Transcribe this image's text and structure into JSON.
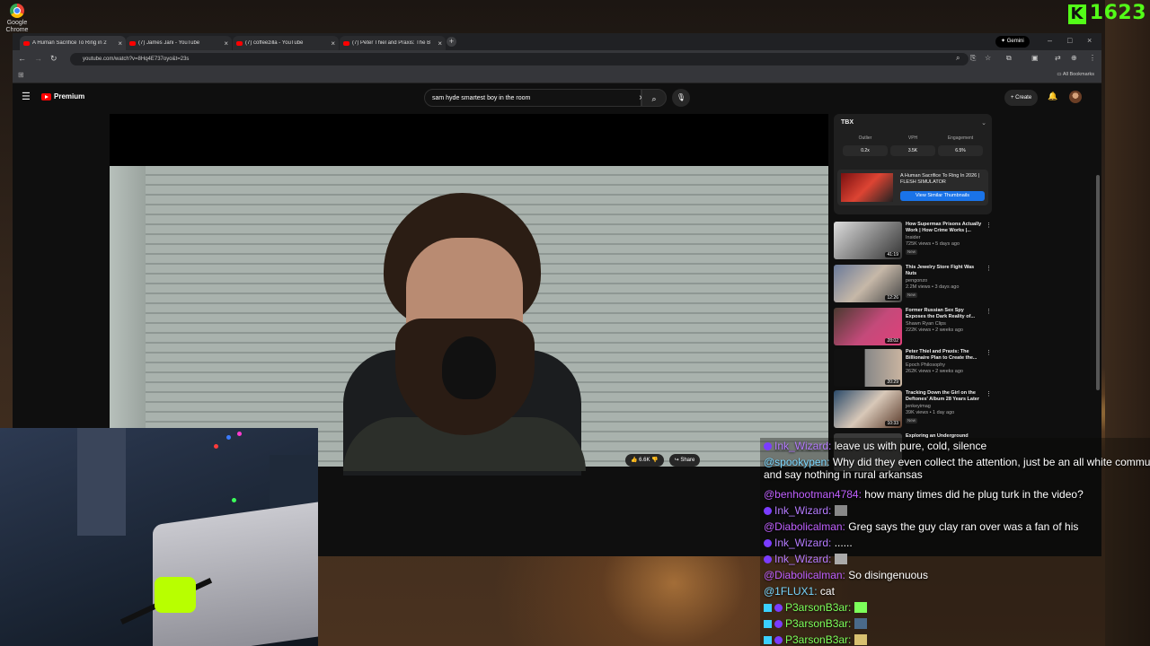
{
  "desktop": {
    "icon_label_1": "Google",
    "icon_label_2": "Chrome",
    "kick_count": "1623",
    "kick_logo": "K"
  },
  "browser": {
    "tabs": [
      {
        "title": "A Human Sacrifice To Ring in 2",
        "active": true
      },
      {
        "title": "(7) James Jani - YouTube"
      },
      {
        "title": "(7) coffeezilla - YouTube"
      },
      {
        "title": "(7) Peter Thiel and Praxis: The B"
      }
    ],
    "gemini_label": "Gemini",
    "url": "youtube.com/watch?v=8Hq4E737oyo&t=23s",
    "bookmarks_label": "All Bookmarks"
  },
  "youtube": {
    "logo_label": "Premium",
    "search_value": "sam hyde smartest boy in the room",
    "create_label": "Create",
    "like_count": "6.6K",
    "share_label": "Share",
    "extension": {
      "logo": "TBX",
      "metrics": [
        {
          "label": "Outlier",
          "value": "0.2x"
        },
        {
          "label": "VPH",
          "value": "3.5K"
        },
        {
          "label": "Engagement",
          "value": "6.5%"
        }
      ],
      "card_title": "A Human Sacrifice To Ring In 2026 | FLESH SIMULATOR",
      "card_button": "View Similar Thumbnails"
    },
    "recommendations": [
      {
        "title": "How Supermax Prisons Actually Work | How Crime Works |...",
        "channel": "Insider",
        "meta": "725K views • 5 days ago",
        "duration": "41:19",
        "new": "New"
      },
      {
        "title": "This Jewelry Store Fight Was Nuts",
        "channel": "pengonzo",
        "meta": "2.2M views • 3 days ago",
        "duration": "12:26",
        "new": "New"
      },
      {
        "title": "Former Russian Sex Spy Exposes the Dark Reality of...",
        "channel": "Shawn Ryan Clips",
        "meta": "222K views • 2 weeks ago",
        "duration": "28:02",
        "new": ""
      },
      {
        "title": "Peter Thiel and Praxis: The Billionaire Plan to Create the...",
        "channel": "Epoch Philosophy",
        "meta": "262K views • 2 weeks ago",
        "duration": "20:29",
        "new": ""
      },
      {
        "title": "Tracking Down the Girl on the Deftones' Album 28 Years Later",
        "channel": "jenkeyimag",
        "meta": "39K views • 1 day ago",
        "duration": "10:33",
        "new": "New"
      },
      {
        "title": "Exploring an Underground",
        "channel": "",
        "meta": "",
        "duration": "",
        "new": ""
      }
    ]
  },
  "chat": [
    {
      "user": "Ink_Wizard:",
      "text": "leave us with pure, cold, silence",
      "color": "#b57bff"
    },
    {
      "user": "@spookypen:",
      "text": "Why did they even collect the attention, just be an all white commun",
      "cont": "and say nothing in rural arkansas",
      "color": "#7ad7ff"
    },
    {
      "user": "@benhootman4784:",
      "text": "how many times did he plug turk in the video?",
      "color": "#c060ff"
    },
    {
      "user": "Ink_Wizard:",
      "text": "",
      "color": "#b57bff"
    },
    {
      "user": "@Diabolicalman:",
      "text": "Greg says the guy clay ran over was a fan of his",
      "color": "#c060ff"
    },
    {
      "user": "Ink_Wizard:",
      "text": "......",
      "color": "#b57bff"
    },
    {
      "user": "Ink_Wizard:",
      "text": "",
      "color": "#b57bff"
    },
    {
      "user": "@Diabolicalman:",
      "text": "So disingenuous",
      "color": "#c060ff"
    },
    {
      "user": "@1FLUX1:",
      "text": "cat",
      "color": "#7ad7ff"
    },
    {
      "user": "P3arsonB3ar:",
      "text": "",
      "color": "#7cff5a"
    },
    {
      "user": "P3arsonB3ar:",
      "text": "",
      "color": "#7cff5a"
    },
    {
      "user": "P3arsonB3ar:",
      "text": "",
      "color": "#7cff5a"
    }
  ]
}
